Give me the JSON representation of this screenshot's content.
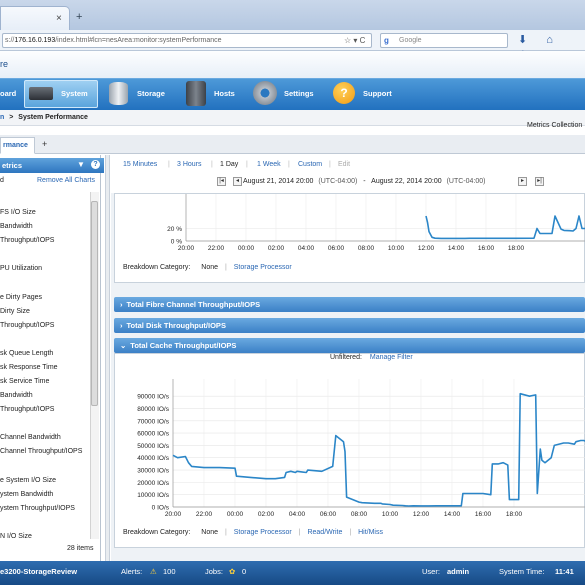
{
  "browser": {
    "tab_close": "×",
    "new_tab": "+",
    "url_prefix": "s://",
    "url_host": "176.16.0.193",
    "url_rest": "/index.html#lcn=nesArea:monitor:systemPerformance",
    "url_icons": "☆ ▾ C",
    "search_placeholder": "Google",
    "search_engine_icon": "g-icon",
    "nav_icons": "⬇ ⌂ ☆"
  },
  "app": {
    "title": "re",
    "nav": [
      {
        "label": "oard",
        "icon": "dashboard-icon"
      },
      {
        "label": "System",
        "icon": "server-icon",
        "active": true
      },
      {
        "label": "Storage",
        "icon": "storage-icon"
      },
      {
        "label": "Hosts",
        "icon": "hosts-icon"
      },
      {
        "label": "Settings",
        "icon": "gear-icon"
      },
      {
        "label": "Support",
        "icon": "help-icon"
      }
    ],
    "breadcrumb_prev": "n",
    "breadcrumb_sep": ">",
    "breadcrumb_current": "System Performance",
    "metrics_collection": "Metrics Collection",
    "tab_label": "rmance",
    "add_tab": "+"
  },
  "left_panel": {
    "title": "etrics",
    "row1_left": "d",
    "remove_all": "Remove All Charts",
    "items": [
      "FS I/O Size",
      "Bandwidth",
      "Throughput/IOPS",
      "",
      "PU Utilization",
      "",
      "e Dirty Pages",
      "Dirty Size",
      "Throughput/IOPS",
      "",
      "sk Queue Length",
      "sk Response Time",
      "sk Service Time",
      "Bandwidth",
      "Throughput/IOPS",
      "",
      "Channel Bandwidth",
      "Channel Throughput/IOPS",
      "",
      "e System I/O Size",
      "ystem Bandwidth",
      "ystem Throughput/IOPS",
      "",
      "N I/O Size"
    ],
    "count": "28 items"
  },
  "time_controls": {
    "ranges": [
      "15 Minutes",
      "3 Hours",
      "1 Day",
      "1 Week",
      "Custom",
      "Edit"
    ],
    "selected": "1 Day",
    "start": "August 21, 2014 20:00",
    "start_tz": "(UTC-04:00)",
    "dash": "-",
    "end": "August 22, 2014 20:00",
    "end_tz": "(UTC-04:00)",
    "btn_first": "|◂",
    "btn_prev": "◂",
    "btn_next": "▸",
    "btn_last": "▸|"
  },
  "chart_top": {
    "breakdown_label": "Breakdown Category:",
    "breakdown_none": "None",
    "breakdown_links": [
      "Storage Processor"
    ]
  },
  "sections": [
    {
      "label": "Total Fibre Channel Throughput/IOPS",
      "expanded": false
    },
    {
      "label": "Total Disk Throughput/IOPS",
      "expanded": false
    },
    {
      "label": "Total Cache Throughput/IOPS",
      "expanded": true
    }
  ],
  "cache_chart": {
    "unfiltered_label": "Unfiltered:",
    "manage_filter": "Manage Filter",
    "breakdown_label": "Breakdown Category:",
    "breakdown_none": "None",
    "breakdown_links": [
      "Storage Processor",
      "Read/Write",
      "Hit/Miss"
    ]
  },
  "status": {
    "system_name": "e3200-StorageReview",
    "alerts_label": "Alerts:",
    "alerts_count": "100",
    "jobs_label": "Jobs:",
    "jobs_count": "0",
    "user_label": "User:",
    "user": "admin",
    "time_label": "System Time:",
    "time": "11:41"
  },
  "colors": {
    "accent": "#2271bf",
    "link": "#2a67b3",
    "series": "#2b86c8"
  },
  "chart_data": [
    {
      "type": "line",
      "title": "",
      "xlabel": "",
      "ylabel": "",
      "x_ticks": [
        "20:00",
        "22:00",
        "00:00",
        "02:00",
        "04:00",
        "06:00",
        "08:00",
        "10:00",
        "12:00",
        "14:00",
        "16:00",
        "18:00"
      ],
      "y_ticks": [
        "0 %",
        "20 %"
      ],
      "ylim": [
        0,
        40
      ],
      "series": [
        {
          "x": [
            16.0,
            16.1,
            16.2,
            16.4,
            16.6,
            16.8,
            17.0,
            18.0,
            18.6,
            18.9,
            20.0,
            21.0,
            22.0,
            23.2,
            23.4,
            23.6,
            24.4,
            24.6,
            25.0,
            25.2,
            25.6,
            25.8,
            26.0,
            26.2,
            26.4,
            26.6,
            26.8,
            27.0,
            27.3,
            27.6
          ],
          "y": [
            40,
            30,
            15,
            6,
            4.5,
            4.3,
            4.2,
            4.2,
            4.2,
            4.3,
            4.3,
            4.3,
            4.4,
            4.5,
            20,
            12,
            12,
            40,
            19,
            17,
            16.5,
            16,
            20,
            40,
            20,
            20,
            25,
            40,
            40,
            40
          ]
        }
      ]
    },
    {
      "type": "line",
      "title": "",
      "xlabel": "",
      "ylabel": "",
      "x_ticks": [
        "20:00",
        "22:00",
        "00:00",
        "02:00",
        "04:00",
        "06:00",
        "08:00",
        "10:00",
        "12:00",
        "14:00",
        "16:00",
        "18:00"
      ],
      "y_ticks": [
        "0 IO/s",
        "10000 IO/s",
        "20000 IO/s",
        "30000 IO/s",
        "40000 IO/s",
        "50000 IO/s",
        "60000 IO/s",
        "70000 IO/s",
        "80000 IO/s",
        "90000 IO/s"
      ],
      "ylim": [
        0,
        95000
      ],
      "series": [
        {
          "x": [
            0.0,
            0.3,
            0.8,
            1.0,
            1.2,
            2.0,
            3.0,
            4.0,
            4.1,
            5.0,
            6.0,
            6.6,
            7.2,
            7.3,
            7.6,
            7.9,
            8.0,
            8.3,
            8.6,
            8.7,
            9.6,
            10.3,
            10.5,
            11.0,
            11.1,
            11.2,
            12.0,
            12.2,
            13.0,
            13.4,
            13.5,
            14.0,
            14.2,
            14.8,
            15.0,
            15.2,
            15.5,
            16.0,
            16.5,
            17.0,
            18.0,
            18.6,
            18.7,
            19.0,
            20.0,
            20.5,
            20.6,
            21.0,
            21.3,
            21.6,
            21.7,
            22.0,
            22.3,
            22.4,
            23.0,
            23.4,
            23.5,
            23.7,
            23.8,
            24.0,
            24.4,
            24.6,
            25.2,
            25.5,
            25.9,
            26.0,
            26.3,
            26.5,
            26.7,
            27.0,
            27.3,
            27.6
          ],
          "y": [
            42000,
            40000,
            41000,
            36000,
            33000,
            32000,
            32000,
            31500,
            25000,
            24000,
            23000,
            23000,
            24000,
            28000,
            29000,
            28000,
            29000,
            28500,
            28000,
            30000,
            29000,
            33000,
            58000,
            53000,
            45000,
            8000,
            4000,
            3500,
            3000,
            3000,
            2500,
            2000,
            1500,
            1200,
            1000,
            800,
            1000,
            900,
            900,
            1000,
            1000,
            1000,
            11000,
            11000,
            11000,
            10000,
            35000,
            35000,
            36000,
            34000,
            6000,
            6000,
            6000,
            92000,
            90000,
            91000,
            11000,
            47000,
            38000,
            36000,
            40000,
            50000,
            52000,
            52000,
            51000,
            53000,
            54000,
            54000,
            53000,
            43000,
            40000,
            40000
          ]
        }
      ]
    }
  ]
}
